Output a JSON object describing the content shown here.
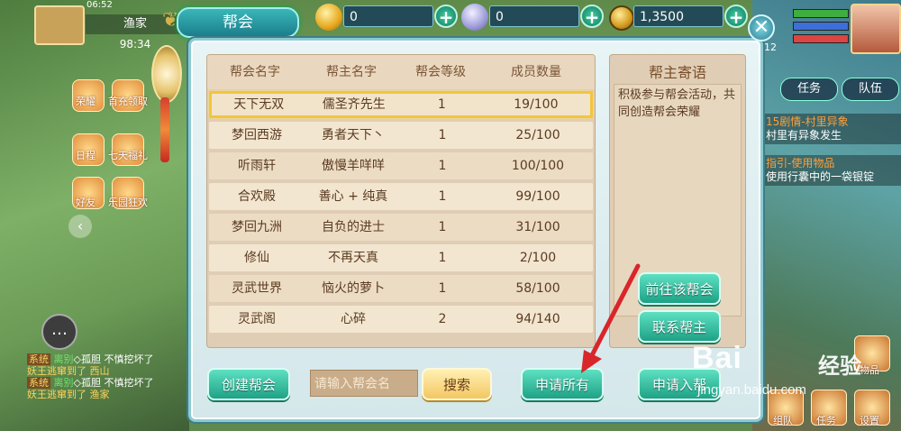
{
  "hud": {
    "clock": "06:52",
    "player_name": "渔家",
    "player_value": "98:34",
    "side_buttons": [
      "荣耀",
      "首充领取",
      "日程",
      "七天福礼",
      "好友",
      "乐园狂欢"
    ],
    "level": "12",
    "team_buttons": [
      "任务",
      "队伍"
    ],
    "quests": [
      {
        "title": "15剧情-村里异象",
        "desc": "村里有异象发生"
      },
      {
        "title": "指引-使用物品",
        "desc": "使用行囊中的一袋银锭"
      }
    ],
    "right_icons": [
      "物品",
      "组队",
      "任务",
      "设置"
    ],
    "chat": [
      {
        "tag": "系统",
        "name": "离别",
        "rest": "◇孤胆 不慎挖坏了"
      },
      {
        "tag": "",
        "name": "",
        "rest": "妖王逃窜到了 西山"
      },
      {
        "tag": "系统",
        "name": "离别",
        "rest": "◇孤胆 不慎挖坏了"
      },
      {
        "tag": "",
        "name": "",
        "rest": "妖王逃窜到了 渔家"
      }
    ]
  },
  "topbar": {
    "title": "帮会",
    "gold": "0",
    "silver": "0",
    "coins": "1,3500",
    "plus": "+",
    "close": "✕"
  },
  "table": {
    "headers": [
      "帮会名字",
      "帮主名字",
      "帮会等级",
      "成员数量"
    ],
    "rows": [
      {
        "name": "天下无双",
        "leader": "儒圣齐先生",
        "level": "1",
        "members": "19/100"
      },
      {
        "name": "梦回西游",
        "leader": "勇者天下丶",
        "level": "1",
        "members": "25/100"
      },
      {
        "name": "听雨轩",
        "leader": "傲慢羊咩咩",
        "level": "1",
        "members": "100/100"
      },
      {
        "name": "合欢殿",
        "leader": "善心 + 纯真",
        "level": "1",
        "members": "99/100"
      },
      {
        "name": "梦回九洲",
        "leader": "自负的进士",
        "level": "1",
        "members": "31/100"
      },
      {
        "name": "修仙",
        "leader": "不再天真",
        "level": "1",
        "members": "2/100"
      },
      {
        "name": "灵武世界",
        "leader": "恼火的萝卜",
        "level": "1",
        "members": "58/100"
      },
      {
        "name": "灵武阁",
        "leader": "心碎",
        "level": "2",
        "members": "94/140"
      }
    ],
    "selected_index": 0
  },
  "aside": {
    "title": "帮主寄语",
    "message": "积极参与帮会活动，共同创造帮会荣耀",
    "goto_label": "前往该帮会",
    "contact_label": "联系帮主"
  },
  "footer": {
    "create_label": "创建帮会",
    "search_placeholder": "请输入帮会名",
    "search_label": "搜索",
    "apply_all_label": "申请所有",
    "apply_label": "申请入帮"
  },
  "watermark": {
    "brand": "Bai",
    "brand2": "经验",
    "url": "jingyan.baidu.com"
  },
  "colors": {
    "accent_teal": "#1ea185",
    "selection": "#f2c53d",
    "annotation_arrow": "#d8262b"
  }
}
